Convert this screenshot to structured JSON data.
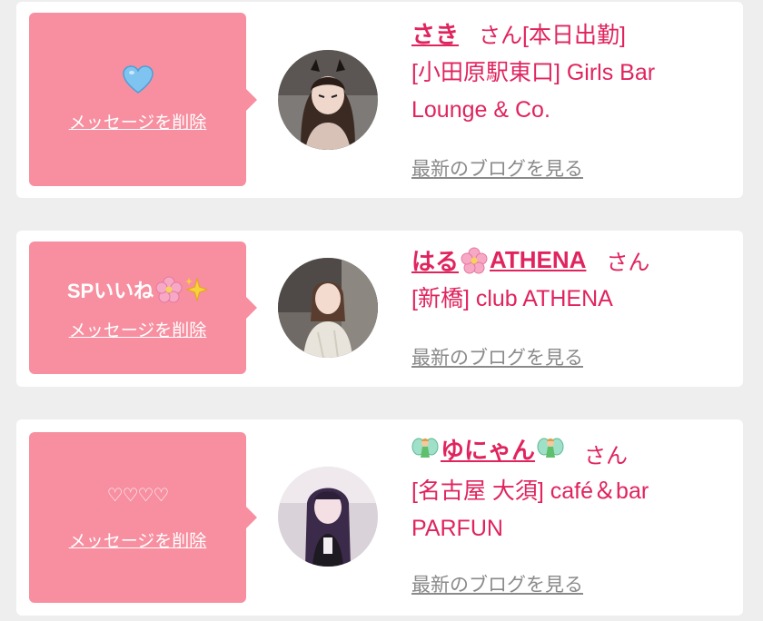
{
  "cards": [
    {
      "message": "",
      "message_icon": "blue-heart-icon",
      "delete_label": "メッセージを削除",
      "name": "さき",
      "honorific": "さん",
      "shop_line1": "[本日出勤]",
      "shop_line2": "[小田原駅東口] Girls Bar",
      "shop_line3": "Lounge & Co.",
      "blog_label": "最新のブログを見る"
    },
    {
      "message": "SPいいね",
      "message_icons": [
        "cherry-blossom-icon",
        "sparkles-icon"
      ],
      "delete_label": "メッセージを削除",
      "name_part1": "はる",
      "name_part2": "ATHENA",
      "honorific": "さん",
      "shop_line1": "[新橋] club ATHENA",
      "blog_label": "最新のブログを見る"
    },
    {
      "message": "♡♡♡♡",
      "delete_label": "メッセージを削除",
      "name": "ゆにゃん",
      "honorific": "さん",
      "shop_line1": "[名古屋 大須] café＆bar",
      "shop_line2": "PARFUN",
      "blog_label": "最新のブログを見る"
    }
  ],
  "colors": {
    "accent": "#e0245e",
    "message_box": "#f78fa0",
    "blog_link": "#8a8a8a",
    "background": "#eeeeee",
    "card": "#ffffff"
  }
}
